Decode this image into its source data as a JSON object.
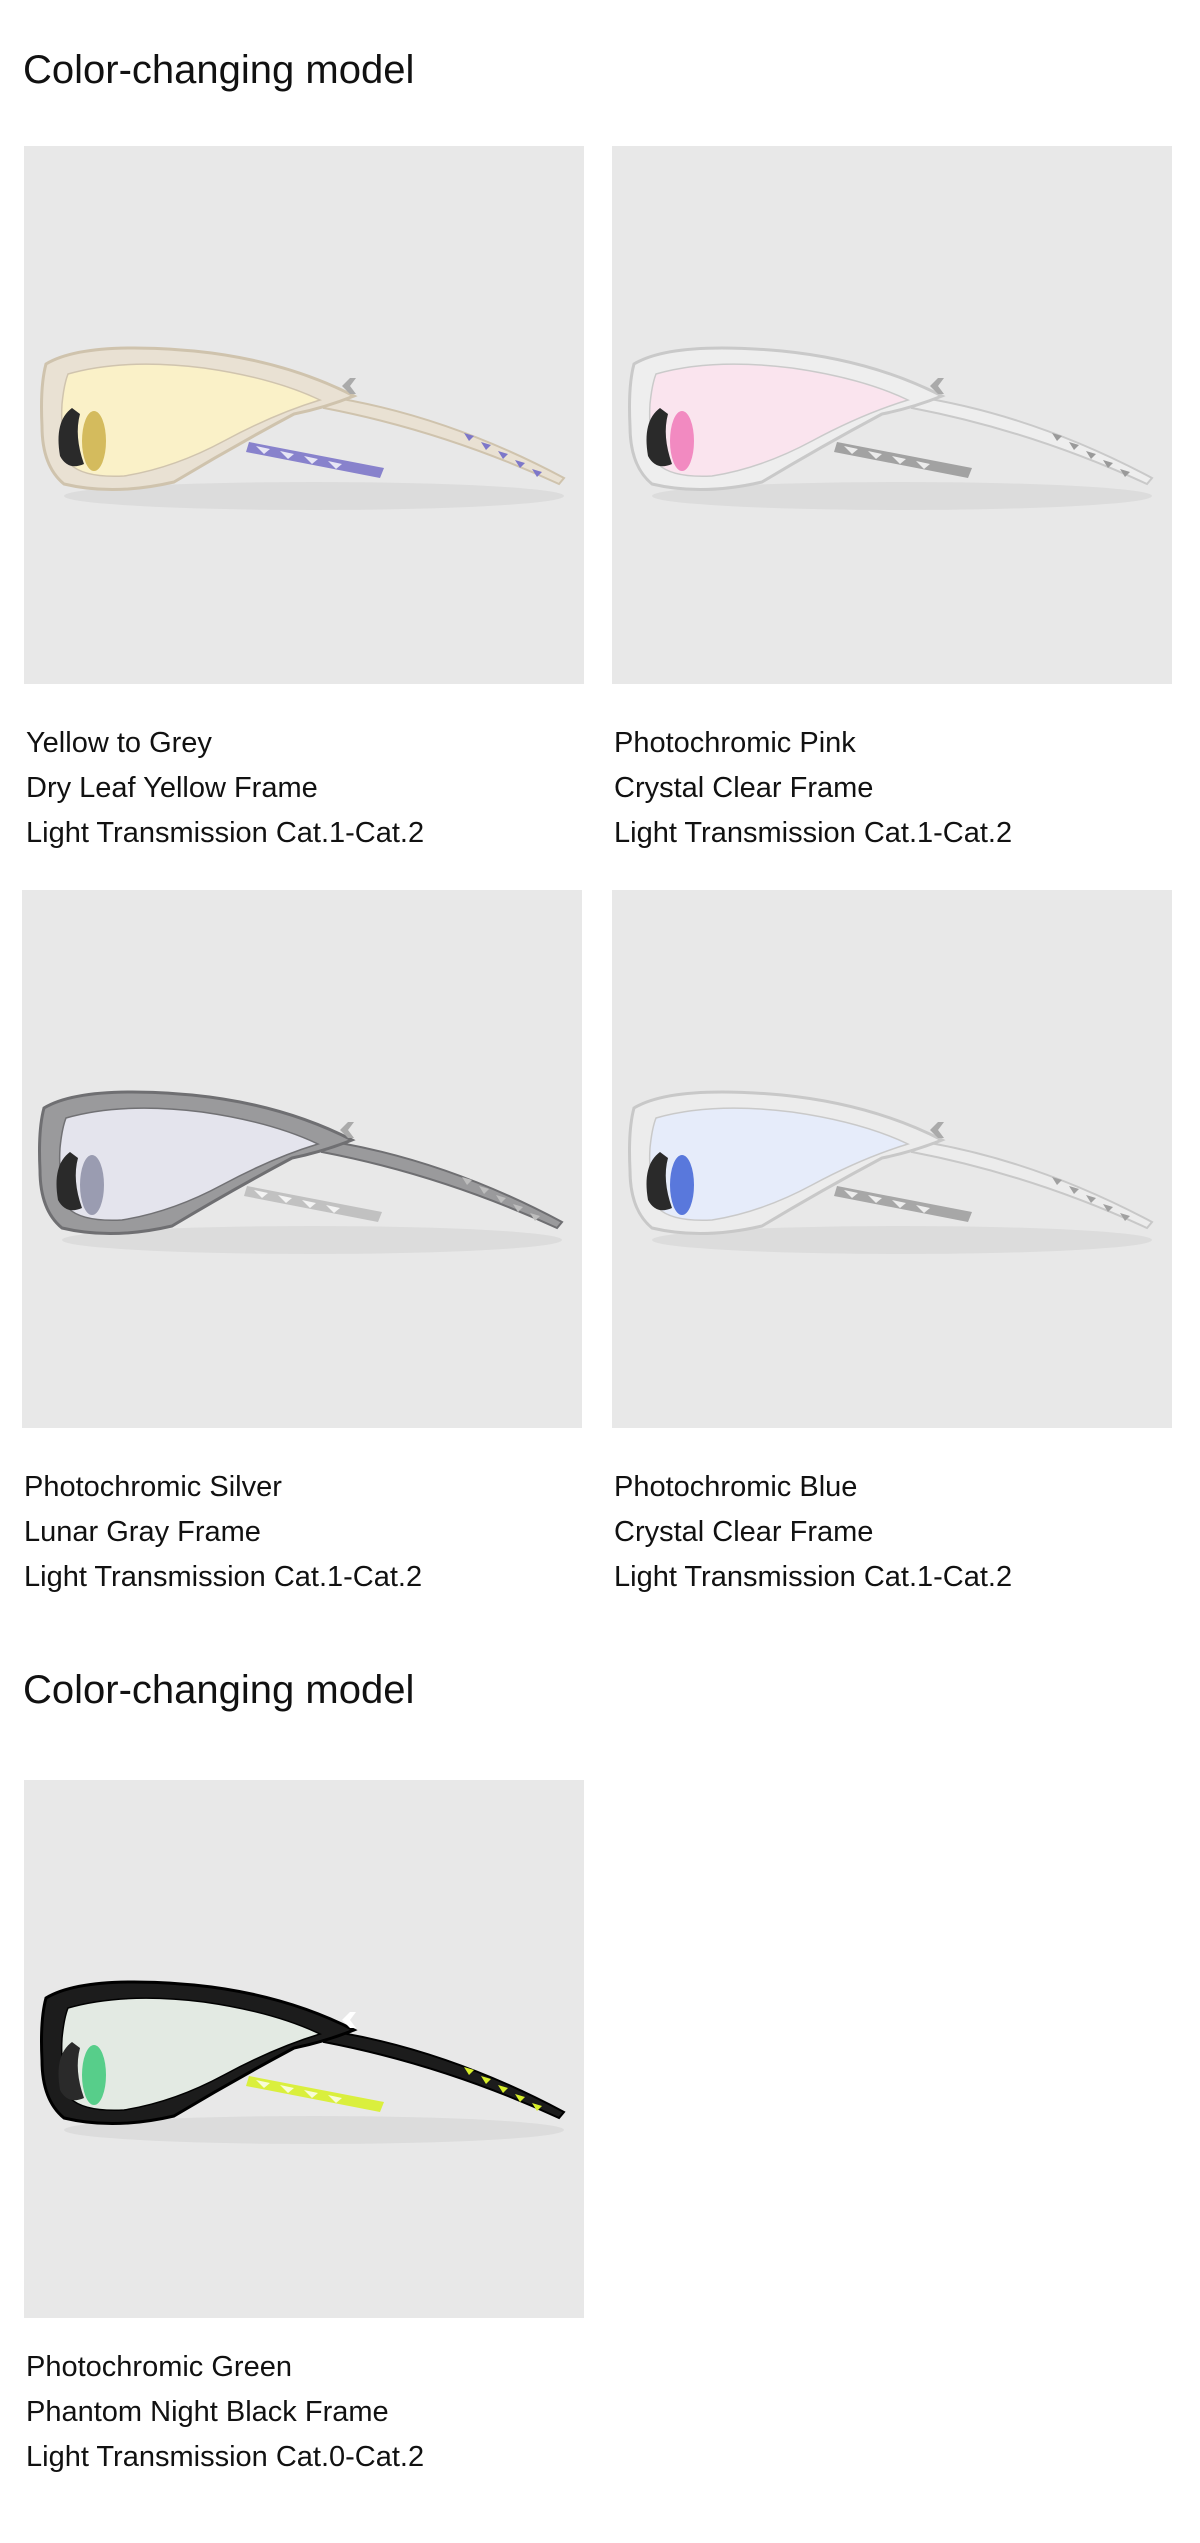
{
  "sections": [
    {
      "title": "Color-changing model",
      "products": [
        {
          "line1": "Yellow to Grey",
          "line2": "Dry Leaf Yellow Frame",
          "line3": "Light Transmission Cat.1-Cat.2",
          "frame_color": "#e9e1d3",
          "frame_edge": "#cfc3ad",
          "lens_tint": "#fbf2c8",
          "lens_accent": "#cdb24a",
          "temple_accent": "#7d77c9"
        },
        {
          "line1": "Photochromic Pink",
          "line2": "Crystal Clear Frame",
          "line3": "Light Transmission Cat.1-Cat.2",
          "frame_color": "#eeeeee",
          "frame_edge": "#c9c9c9",
          "lens_tint": "#fbe4ee",
          "lens_accent": "#f07ab8",
          "temple_accent": "#9a9a9a"
        },
        {
          "line1": "Photochromic Silver",
          "line2": "Lunar Gray Frame",
          "line3": "Light Transmission Cat.1-Cat.2",
          "frame_color": "#9a9a9c",
          "frame_edge": "#6f6f72",
          "lens_tint": "#e8e8f2",
          "lens_accent": "#8d8fa6",
          "temple_accent": "#bdbdbd"
        },
        {
          "line1": "Photochromic Blue",
          "line2": "Crystal Clear Frame",
          "line3": "Light Transmission Cat.1-Cat.2",
          "frame_color": "#ececec",
          "frame_edge": "#c8c8c8",
          "lens_tint": "#e6ecfb",
          "lens_accent": "#3f64d6",
          "temple_accent": "#a0a0a0"
        }
      ]
    },
    {
      "title": "Color-changing model",
      "products": [
        {
          "line1": "Photochromic Green",
          "line2": "Phantom Night Black Frame",
          "line3": "Light Transmission Cat.0-Cat.2",
          "frame_color": "#1c1c1c",
          "frame_edge": "#000000",
          "lens_tint": "#eef6ee",
          "lens_accent": "#3ec97a",
          "temple_accent": "#d8ef2a"
        }
      ]
    }
  ]
}
